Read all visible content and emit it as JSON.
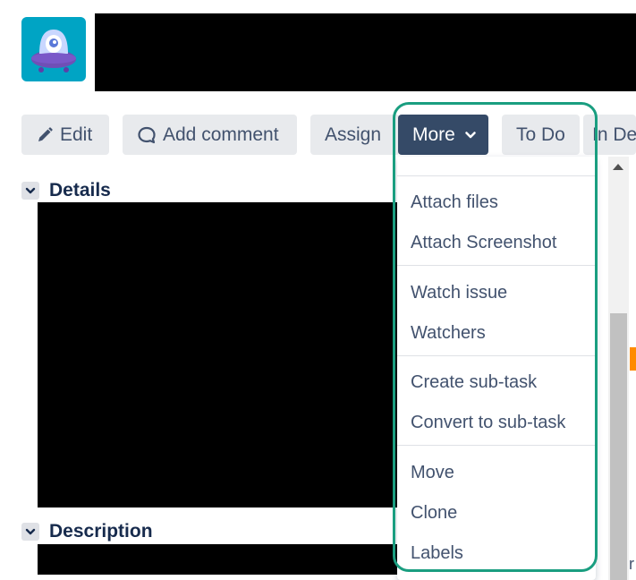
{
  "toolbar": {
    "edit": "Edit",
    "add_comment": "Add comment",
    "assign": "Assign",
    "more": "More",
    "todo": "To Do",
    "in_dev_partial": "In De"
  },
  "sections": {
    "details": "Details",
    "description": "Description"
  },
  "more_menu": {
    "groups": [
      [
        "Attach files",
        "Attach Screenshot"
      ],
      [
        "Watch issue",
        "Watchers"
      ],
      [
        "Create sub-task",
        "Convert to sub-task"
      ],
      [
        "Move",
        "Clone",
        "Labels"
      ]
    ]
  },
  "colors": {
    "more_button": "#354a67",
    "focus_ring": "#1a9e80",
    "logo_bg": "#00a4c4",
    "status_orange": "#ff8b00"
  },
  "icons": {
    "edit": "pencil-icon",
    "comment": "speech-bubble-icon",
    "more": "chevron-down-icon",
    "details": "chevron-down-icon",
    "description": "chevron-down-icon",
    "logo": "alien-ufo-logo"
  },
  "edge_text": "r"
}
